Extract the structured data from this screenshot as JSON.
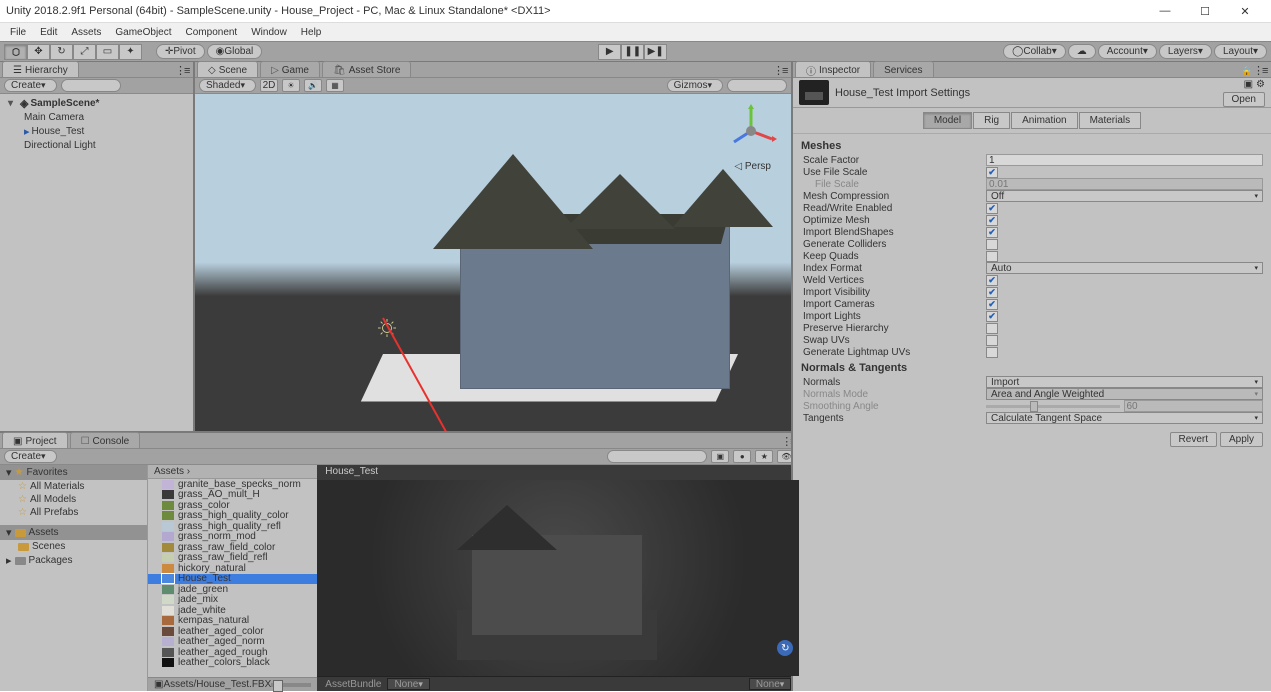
{
  "window": {
    "title": "Unity 2018.2.9f1 Personal (64bit) - SampleScene.unity - House_Project - PC, Mac & Linux Standalone* <DX11>"
  },
  "menu": {
    "items": [
      "File",
      "Edit",
      "Assets",
      "GameObject",
      "Component",
      "Window",
      "Help"
    ]
  },
  "toolbar": {
    "pivot": "Pivot",
    "global": "Global",
    "collab": "Collab",
    "account": "Account",
    "layers": "Layers",
    "layout": "Layout"
  },
  "hierarchy": {
    "tab": "Hierarchy",
    "create": "Create",
    "scene": "SampleScene*",
    "items": [
      "Main Camera",
      "House_Test",
      "Directional Light"
    ]
  },
  "scene_panel": {
    "tabs": [
      "Scene",
      "Game",
      "Asset Store"
    ],
    "shaded": "Shaded",
    "twod": "2D",
    "gizmos": "Gizmos",
    "persp": "Persp"
  },
  "project": {
    "tabs": [
      "Project",
      "Console"
    ],
    "create": "Create",
    "favorites_hdr": "Favorites",
    "favorites": [
      "All Materials",
      "All Models",
      "All Prefabs"
    ],
    "assets_hdr": "Assets",
    "assets_children": [
      "Scenes"
    ],
    "packages_hdr": "Packages",
    "list_hdr": "Assets",
    "assets": [
      {
        "name": "granite_base_specks_norm",
        "c": "#c2b4d6"
      },
      {
        "name": "grass_AO_mult_H",
        "c": "#3a3a3a"
      },
      {
        "name": "grass_color",
        "c": "#6e8a3d"
      },
      {
        "name": "grass_high_quality_color",
        "c": "#6e8a3d"
      },
      {
        "name": "grass_high_quality_refl",
        "c": "#b8c8d4"
      },
      {
        "name": "grass_norm_mod",
        "c": "#b2a8d0"
      },
      {
        "name": "grass_raw_field_color",
        "c": "#a28a3c"
      },
      {
        "name": "grass_raw_field_refl",
        "c": "#c6ceb0"
      },
      {
        "name": "hickory_natural",
        "c": "#cc8a3e"
      },
      {
        "name": "House_Test",
        "c": "#4a88e0",
        "sel": true
      },
      {
        "name": "jade_green",
        "c": "#5e8c6e"
      },
      {
        "name": "jade_mix",
        "c": "#d0d8c8"
      },
      {
        "name": "jade_white",
        "c": "#e0e0d8"
      },
      {
        "name": "kempas_natural",
        "c": "#a86a3c"
      },
      {
        "name": "leather_aged_color",
        "c": "#6a4a3a"
      },
      {
        "name": "leather_aged_norm",
        "c": "#b8b0d0"
      },
      {
        "name": "leather_aged_rough",
        "c": "#555"
      },
      {
        "name": "leather_colors_black",
        "c": "#111"
      }
    ],
    "path": "Assets/House_Test.FBX"
  },
  "preview": {
    "title": "House_Test",
    "assetbundle": "AssetBundle",
    "none": "None"
  },
  "inspector": {
    "tabs": [
      "Inspector",
      "Services"
    ],
    "title": "House_Test Import Settings",
    "open": "Open",
    "cattabs": [
      "Model",
      "Rig",
      "Animation",
      "Materials"
    ],
    "meshes_hdr": "Meshes",
    "scale_factor_l": "Scale Factor",
    "scale_factor_v": "1",
    "use_file_scale_l": "Use File Scale",
    "file_scale_l": "File Scale",
    "file_scale_v": "0.01",
    "mesh_comp_l": "Mesh Compression",
    "mesh_comp_v": "Off",
    "rw_l": "Read/Write Enabled",
    "opt_mesh_l": "Optimize Mesh",
    "blend_l": "Import BlendShapes",
    "gencol_l": "Generate Colliders",
    "keepq_l": "Keep Quads",
    "indexf_l": "Index Format",
    "indexf_v": "Auto",
    "weld_l": "Weld Vertices",
    "impvis_l": "Import Visibility",
    "impcam_l": "Import Cameras",
    "implgt_l": "Import Lights",
    "preshier_l": "Preserve Hierarchy",
    "swapuv_l": "Swap UVs",
    "genlm_l": "Generate Lightmap UVs",
    "norm_hdr": "Normals & Tangents",
    "normals_l": "Normals",
    "normals_v": "Import",
    "normmode_l": "Normals Mode",
    "normmode_v": "Area and Angle Weighted",
    "smooth_l": "Smoothing Angle",
    "smooth_v": "60",
    "tang_l": "Tangents",
    "tang_v": "Calculate Tangent Space",
    "revert": "Revert",
    "apply": "Apply"
  }
}
